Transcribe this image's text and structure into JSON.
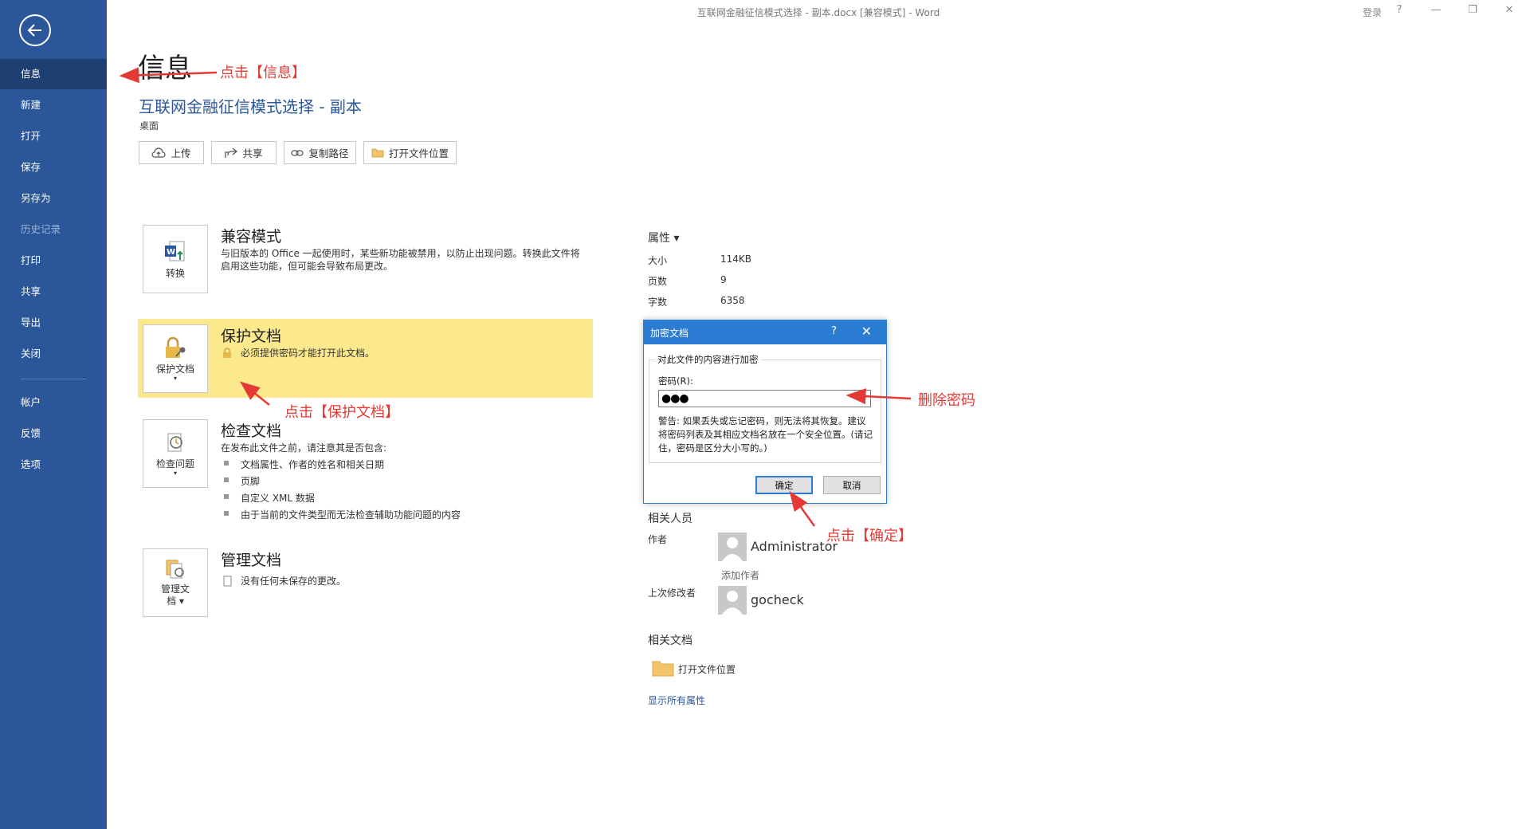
{
  "window": {
    "title": "互联网金融征信模式选择 - 副本.docx [兼容模式]  -  Word",
    "signin": "登录",
    "help": "?",
    "minimize": "—",
    "restore": "❐",
    "close": "✕"
  },
  "sidebar": {
    "items": [
      {
        "label": "信息"
      },
      {
        "label": "新建"
      },
      {
        "label": "打开"
      },
      {
        "label": "保存"
      },
      {
        "label": "另存为"
      },
      {
        "label": "历史记录"
      },
      {
        "label": "打印"
      },
      {
        "label": "共享"
      },
      {
        "label": "导出"
      },
      {
        "label": "关闭"
      },
      {
        "label": "帐户"
      },
      {
        "label": "反馈"
      },
      {
        "label": "选项"
      }
    ]
  },
  "main": {
    "page_title": "信息",
    "doc_title": "互联网金融征信模式选择 - 副本",
    "doc_location": "桌面",
    "actions": {
      "upload": "上传",
      "share": "共享",
      "copy_path": "复制路径",
      "open_location": "打开文件位置"
    }
  },
  "sections": {
    "compat": {
      "tile_label": "转换",
      "title": "兼容模式",
      "desc_line1": "与旧版本的 Office 一起使用时，某些新功能被禁用，以防止出现问题。转换此文件将",
      "desc_line2": "启用这些功能，但可能会导致布局更改。"
    },
    "protect": {
      "tile_label": "保护文档",
      "title": "保护文档",
      "desc": "必须提供密码才能打开此文档。"
    },
    "inspect": {
      "tile_label": "检查问题",
      "title": "检查文档",
      "desc": "在发布此文件之前，请注意其是否包含:",
      "bullets": [
        "文档属性、作者的姓名和相关日期",
        "页脚",
        "自定义 XML 数据",
        "由于当前的文件类型而无法检查辅助功能问题的内容"
      ]
    },
    "manage": {
      "tile_label_line1": "管理文",
      "tile_label_line2": "档",
      "title": "管理文档",
      "desc": "没有任何未保存的更改。"
    }
  },
  "properties": {
    "heading": "属性 ▾",
    "size_label": "大小",
    "size_value": "114KB",
    "pages_label": "页数",
    "pages_value": "9",
    "words_label": "字数",
    "words_value": "6358"
  },
  "people": {
    "heading": "相关人员",
    "author_label": "作者",
    "author_name": "Administrator",
    "add_author": "添加作者",
    "last_modified_label": "上次修改者",
    "last_modified_name": "gocheck"
  },
  "related_docs": {
    "heading": "相关文档",
    "open_location": "打开文件位置",
    "show_all": "显示所有属性"
  },
  "dialog": {
    "title": "加密文档",
    "help": "?",
    "close": "✕",
    "group_label": "对此文件的内容进行加密",
    "password_label": "密码(R):",
    "password_value": "●●●",
    "warning": "警告: 如果丢失或忘记密码，则无法将其恢复。建议将密码列表及其相应文档名放在一个安全位置。(请记住，密码是区分大小写的。)",
    "ok": "确定",
    "cancel": "取消"
  },
  "annotations": {
    "info": "点击【信息】",
    "protect": "点击【保护文档】",
    "delete_pw": "删除密码",
    "ok": "点击【确定】"
  },
  "colors": {
    "sidebar": "#2b579a",
    "sidebar_active": "#1e3f72",
    "protect_band": "#fde98d",
    "dialog_accent": "#2b7cd3",
    "annotation": "#e53935"
  }
}
